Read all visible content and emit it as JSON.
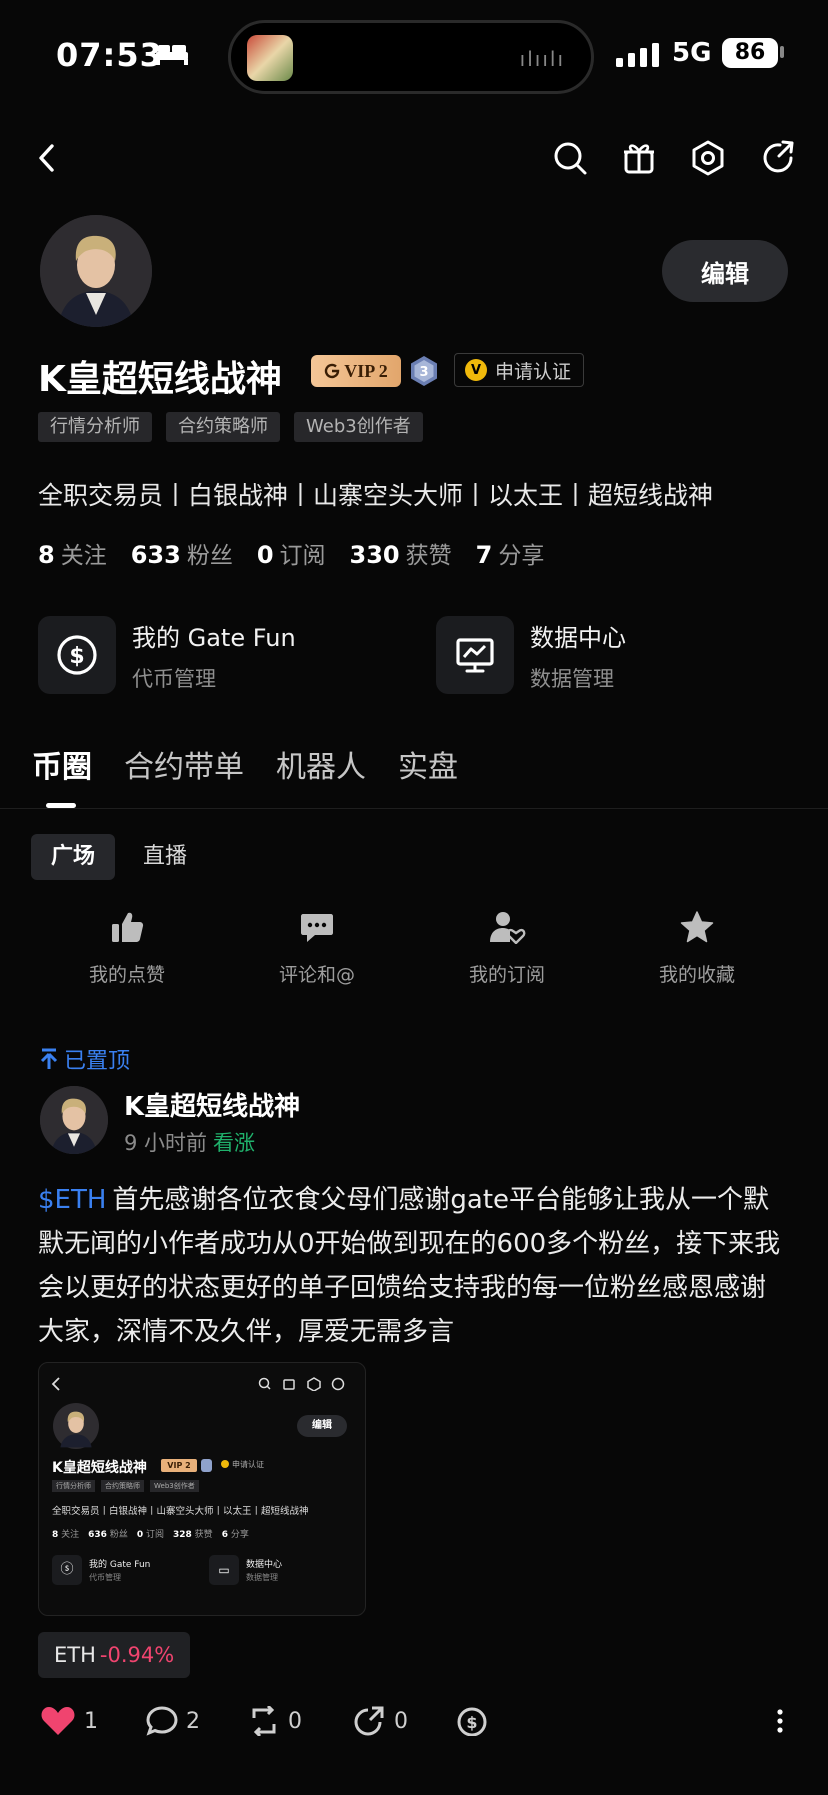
{
  "status_bar": {
    "time": "07:53",
    "network": "5G",
    "battery": "86"
  },
  "profile": {
    "edit_label": "编辑",
    "name": "K皇超短线战神",
    "vip_label": "VIP 2",
    "level_badge": "3",
    "verify_label": "申请认证",
    "tags": [
      "行情分析师",
      "合约策略师",
      "Web3创作者"
    ],
    "bio": "全职交易员丨白银战神丨山寨空头大师丨以太王丨超短线战神",
    "stats": [
      {
        "value": "8",
        "label": "关注"
      },
      {
        "value": "633",
        "label": "粉丝"
      },
      {
        "value": "0",
        "label": "订阅"
      },
      {
        "value": "330",
        "label": "获赞"
      },
      {
        "value": "7",
        "label": "分享"
      }
    ],
    "tools": [
      {
        "title": "我的 Gate Fun",
        "subtitle": "代币管理",
        "icon": "dollar-circle-icon"
      },
      {
        "title": "数据中心",
        "subtitle": "数据管理",
        "icon": "chart-monitor-icon"
      }
    ]
  },
  "tabs": [
    "币圈",
    "合约带单",
    "机器人",
    "实盘"
  ],
  "active_tab": "币圈",
  "sub_tabs": [
    "广场",
    "直播"
  ],
  "quick_actions": [
    {
      "label": "我的点赞",
      "icon": "thumbs-up-icon"
    },
    {
      "label": "评论和@",
      "icon": "comment-icon"
    },
    {
      "label": "我的订阅",
      "icon": "subscribe-icon"
    },
    {
      "label": "我的收藏",
      "icon": "star-icon"
    }
  ],
  "post": {
    "pinned_label": "已置顶",
    "author": "K皇超短线战神",
    "time": "9 小时前",
    "sentiment": "看涨",
    "ticker": "$ETH",
    "text": "首先感谢各位衣食父母们感谢gate平台能够让我从一个默默无闻的小作者成功从0开始做到现在的600多个粉丝，接下来我会以更好的状态更好的单子回馈给支持我的每一位粉丝感恩感谢大家，深情不及久伴，厚爱无需多言",
    "screenshot": {
      "edit_label": "编辑",
      "name": "K皇超短线战神",
      "vip_label": "VIP 2",
      "verify_label": "申请认证",
      "tags": [
        "行情分析师",
        "合约策略师",
        "Web3创作者"
      ],
      "bio": "全职交易员丨白银战神丨山寨空头大师丨以太王丨超短线战神",
      "stats": [
        {
          "value": "8",
          "label": "关注"
        },
        {
          "value": "636",
          "label": "粉丝"
        },
        {
          "value": "0",
          "label": "订阅"
        },
        {
          "value": "328",
          "label": "获赞"
        },
        {
          "value": "6",
          "label": "分享"
        }
      ],
      "tools": [
        {
          "title": "我的 Gate Fun",
          "subtitle": "代币管理"
        },
        {
          "title": "数据中心",
          "subtitle": "数据管理"
        }
      ]
    },
    "coin_tag": {
      "symbol": "ETH",
      "change": "-0.94%"
    },
    "actions": [
      {
        "icon": "heart-icon",
        "count": "1"
      },
      {
        "icon": "comment-icon",
        "count": "2"
      },
      {
        "icon": "repost-icon",
        "count": "0"
      },
      {
        "icon": "share-icon",
        "count": "0"
      },
      {
        "icon": "tip-icon",
        "count": ""
      }
    ]
  },
  "colors": {
    "accent_blue": "#3a80f0",
    "up_green": "#20b26c",
    "down_red": "#f0446f",
    "like_red": "#f0446f",
    "vip_gold": "#e8b07a"
  }
}
